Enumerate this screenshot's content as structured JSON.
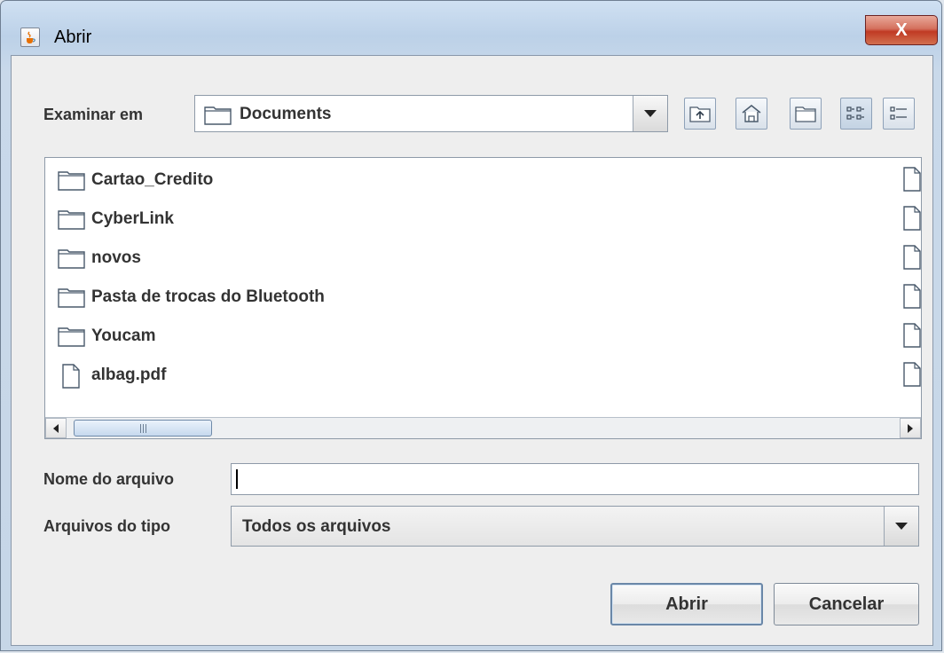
{
  "window": {
    "title": "Abrir",
    "close_glyph": "X"
  },
  "toolbar": {
    "look_in_label": "Examinar em",
    "current_folder": "Documents",
    "buttons": [
      "up-folder-icon",
      "home-icon",
      "new-folder-icon",
      "list-view-icon",
      "details-view-icon"
    ]
  },
  "files": [
    {
      "name": "Cartao_Credito",
      "icon": "folder-icon"
    },
    {
      "name": "CyberLink",
      "icon": "folder-icon"
    },
    {
      "name": "novos",
      "icon": "folder-icon"
    },
    {
      "name": "Pasta de trocas do Bluetooth",
      "icon": "folder-icon"
    },
    {
      "name": "Youcam",
      "icon": "folder-icon"
    },
    {
      "name": "albag.pdf",
      "icon": "file-icon"
    }
  ],
  "filename": {
    "label": "Nome do arquivo",
    "value": ""
  },
  "filetype": {
    "label": "Arquivos do tipo",
    "selected": "Todos os arquivos"
  },
  "actions": {
    "open_label": "Abrir",
    "cancel_label": "Cancelar"
  },
  "colors": {
    "selected_view_button": "#c4d3e3",
    "close_button": "#c03a23"
  }
}
